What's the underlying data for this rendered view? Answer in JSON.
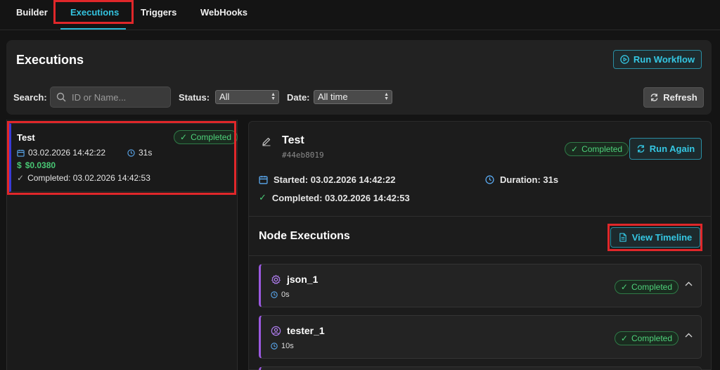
{
  "tabs": [
    {
      "label": "Builder"
    },
    {
      "label": "Executions"
    },
    {
      "label": "Triggers"
    },
    {
      "label": "WebHooks"
    }
  ],
  "header": {
    "title": "Executions",
    "run_workflow_label": "Run Workflow",
    "search_label": "Search:",
    "search_placeholder": "ID or Name...",
    "status_label": "Status:",
    "status_value": "All",
    "date_label": "Date:",
    "date_value": "All time",
    "refresh_label": "Refresh"
  },
  "execution_list": [
    {
      "name": "Test",
      "status": "Completed",
      "date": "03.02.2026 14:42:22",
      "duration": "31s",
      "cost": "$0.0380",
      "completed": "Completed: 03.02.2026 14:42:53"
    }
  ],
  "detail": {
    "title": "Test",
    "id": "#44eb8019",
    "status": "Completed",
    "run_again_label": "Run Again",
    "started": "Started: 03.02.2026 14:42:22",
    "duration": "Duration: 31s",
    "completed": "Completed: 03.02.2026 14:42:53",
    "node_executions_title": "Node Executions",
    "view_timeline_label": "View Timeline",
    "nodes": [
      {
        "name": "json_1",
        "duration": "0s",
        "status": "Completed",
        "icon": "gear-icon"
      },
      {
        "name": "tester_1",
        "duration": "10s",
        "status": "Completed",
        "icon": "user-icon"
      }
    ]
  },
  "colors": {
    "accent": "#35c7e3",
    "success": "#4fd17a",
    "node_border": "#9b59e0",
    "highlight": "#e0272a"
  }
}
